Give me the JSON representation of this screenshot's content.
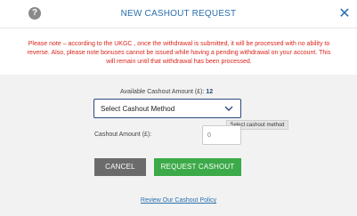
{
  "header": {
    "help_glyph": "?",
    "title": "NEW CASHOUT REQUEST",
    "close_glyph": "✕"
  },
  "notice": {
    "text": "Please note – according to the UKGC , once the withdrawal is submitted, it will be processed with no ability to reverse. Also, please note bonuses cannot be issued while having a pending withdrawal on your account. This will remain until that withdrawal has been processed."
  },
  "form": {
    "available_label": "Available Cashout Amount (£):",
    "available_value": "12",
    "method_select_value": "Select Cashout Method",
    "method_tooltip": "Select cashout method",
    "amount_label": "Cashout Amount (£):",
    "amount_placeholder": "0"
  },
  "buttons": {
    "cancel": "CANCEL",
    "request": "REQUEST CASHOUT"
  },
  "links": {
    "policy": "Review Our Cashout Policy"
  },
  "colors": {
    "accent": "#2a6fb0",
    "warning": "#d9261c",
    "confirm": "#3caa48",
    "cancel": "#6b6b6b",
    "panel_bg": "#f2f2f2"
  },
  "icons": {
    "help": "help-icon",
    "close": "close-icon",
    "dropdown": "chevron-down-icon"
  }
}
